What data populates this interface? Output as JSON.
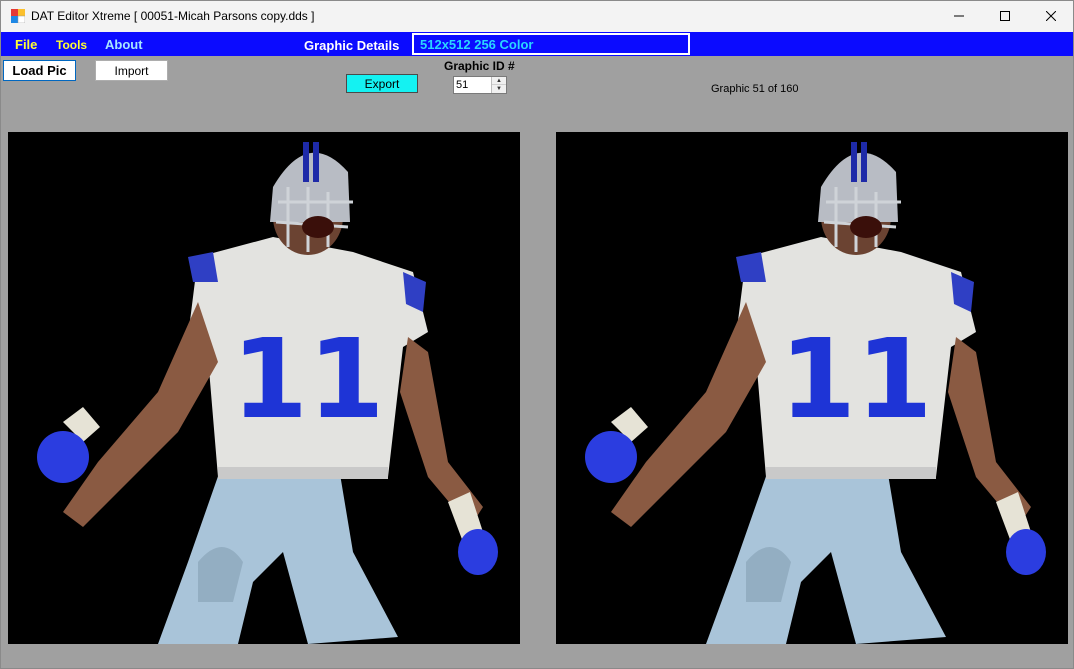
{
  "window": {
    "title": "DAT Editor Xtreme [ 00051-Micah Parsons copy.dds ]",
    "controls": [
      "minimize-icon",
      "maximize-icon",
      "close-icon"
    ]
  },
  "menu": {
    "file": "File",
    "tools": "Tools",
    "about": "About",
    "graphic_details_label": "Graphic Details",
    "graphic_details_value": "512x512 256 Color"
  },
  "toolbar": {
    "load_pic": "Load Pic",
    "import": "Import",
    "export": "Export",
    "graphic_id_label": "Graphic ID #",
    "graphic_id_value": "51",
    "graphic_count": "Graphic 51 of 160"
  },
  "panels": {
    "left": {
      "image": "football-player-in-white-jersey-number-11"
    },
    "right": {
      "image": "football-player-in-white-jersey-number-11"
    }
  },
  "jersey_number": "11",
  "colors": {
    "menubar": "#0b0bff",
    "menu_text": "#ffff33",
    "details_value": "#2ad6ff",
    "export_button": "#14f2f2",
    "canvas_background": "#000000",
    "window_background": "#a0a0a0"
  }
}
